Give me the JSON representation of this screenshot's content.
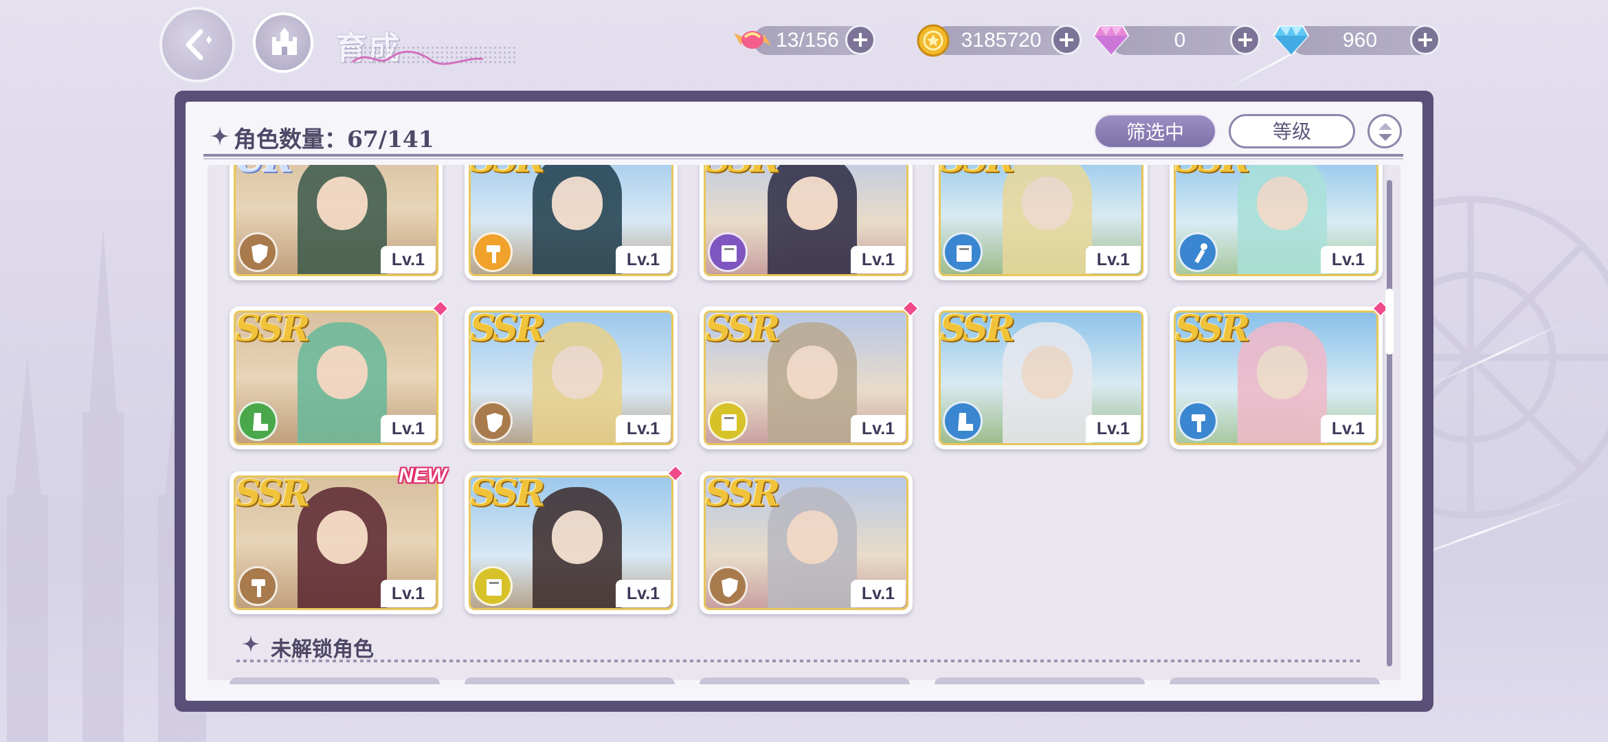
{
  "header": {
    "title": "育成",
    "resources": [
      {
        "name": "candy-icon",
        "value": "13/156"
      },
      {
        "name": "gold-coin-icon",
        "value": "3185720"
      },
      {
        "name": "pink-gem-icon",
        "value": "0"
      },
      {
        "name": "blue-diamond-icon",
        "value": "960"
      }
    ]
  },
  "panel": {
    "count_label": "角色数量：67/141",
    "filter_label": "筛选中",
    "sort_label": "等级",
    "locked_section_label": "未解锁角色"
  },
  "colors": {
    "frame": "#5a4f77",
    "accent": "#8c80ba",
    "gold_border": "#e8c65a",
    "new_pink": "#e0306e"
  },
  "cards": [
    {
      "rarity": "UR",
      "level": "Lv.1",
      "class_icon": "shield-icon",
      "class_color": "#a87a4c",
      "new": false,
      "red_dot": false
    },
    {
      "rarity": "SSR",
      "level": "Lv.1",
      "class_icon": "hammer-icon",
      "class_color": "#f0a22a",
      "new": false,
      "red_dot": false
    },
    {
      "rarity": "SSR",
      "level": "Lv.1",
      "class_icon": "book-icon",
      "class_color": "#7f55c0",
      "new": false,
      "red_dot": false
    },
    {
      "rarity": "SSR",
      "level": "Lv.1",
      "class_icon": "book-icon",
      "class_color": "#3a86d0",
      "new": false,
      "red_dot": false
    },
    {
      "rarity": "SSR",
      "level": "Lv.1",
      "class_icon": "wand-icon",
      "class_color": "#3a86d0",
      "new": false,
      "red_dot": false
    },
    {
      "rarity": "SSR",
      "level": "Lv.1",
      "class_icon": "boot-icon",
      "class_color": "#4aa84a",
      "new": false,
      "red_dot": true
    },
    {
      "rarity": "SSR",
      "level": "Lv.1",
      "class_icon": "shield-icon",
      "class_color": "#a87a4c",
      "new": false,
      "red_dot": false
    },
    {
      "rarity": "SSR",
      "level": "Lv.1",
      "class_icon": "book-icon",
      "class_color": "#d8c22a",
      "new": false,
      "red_dot": true
    },
    {
      "rarity": "SSR",
      "level": "Lv.1",
      "class_icon": "boot-icon",
      "class_color": "#3a86d0",
      "new": false,
      "red_dot": false
    },
    {
      "rarity": "SSR",
      "level": "Lv.1",
      "class_icon": "hammer-icon",
      "class_color": "#3a86d0",
      "new": false,
      "red_dot": true
    },
    {
      "rarity": "SSR",
      "level": "Lv.1",
      "class_icon": "hammer-icon",
      "class_color": "#a87a4c",
      "new": true,
      "new_label": "NEW",
      "red_dot": false
    },
    {
      "rarity": "SSR",
      "level": "Lv.1",
      "class_icon": "book-icon",
      "class_color": "#d8c22a",
      "new": false,
      "red_dot": true
    },
    {
      "rarity": "SSR",
      "level": "Lv.1",
      "class_icon": "shield-icon",
      "class_color": "#a87a4c",
      "new": false,
      "red_dot": false
    }
  ]
}
